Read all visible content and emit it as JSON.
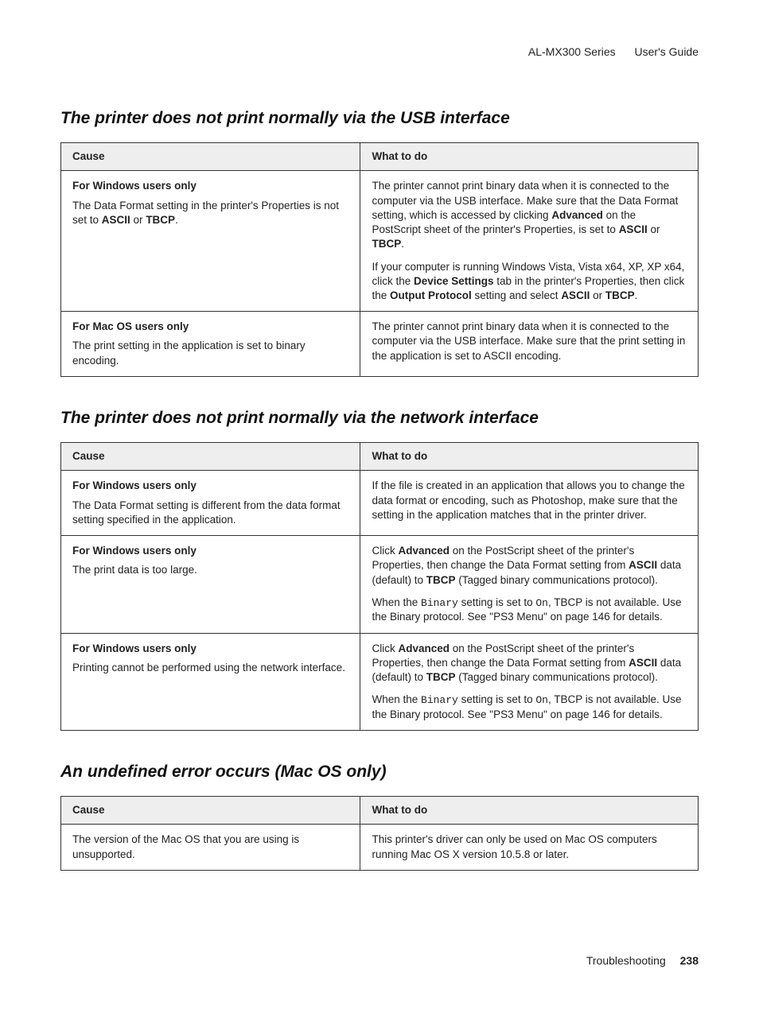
{
  "header": {
    "product": "AL-MX300 Series",
    "doc": "User's Guide"
  },
  "sections": {
    "s1": {
      "heading": "The printer does not print normally via the USB interface",
      "thCause": "Cause",
      "thWhat": "What to do",
      "rows": {
        "r1": {
          "causeTitle": "For Windows users only",
          "causeBody_a": "The Data Format setting in the printer's Properties is not set to ",
          "causeBody_b": " or ",
          "causeBody_c": ".",
          "do_p1_a": "The printer cannot print binary data when it is connected to the computer via the USB interface. Make sure that the Data Format setting, which is accessed by clicking ",
          "do_p1_b": " on the PostScript sheet of the printer's Properties, is set to ",
          "do_p1_c": " or ",
          "do_p1_d": ".",
          "do_p2_a": "If your computer is running Windows Vista, Vista x64, XP, XP x64, click the ",
          "do_p2_b": " tab in the printer's Properties, then click the ",
          "do_p2_c": " setting and select ",
          "do_p2_d": " or ",
          "do_p2_e": ".",
          "k_ascii": "ASCII",
          "k_tbcp": "TBCP",
          "k_adv": "Advanced",
          "k_devset": "Device Settings",
          "k_outproto": "Output Protocol"
        },
        "r2": {
          "causeTitle": "For Mac OS users only",
          "causeBody": "The print setting in the application is set to binary encoding.",
          "do": "The printer cannot print binary data when it is connected to the computer via the USB interface. Make sure that the print setting in the application is set to ASCII encoding."
        }
      }
    },
    "s2": {
      "heading": "The printer does not print normally via the network interface",
      "thCause": "Cause",
      "thWhat": "What to do",
      "rows": {
        "r1": {
          "causeTitle": "For Windows users only",
          "causeBody": "The Data Format setting is different from the data format setting specified in the application.",
          "do": "If the file is created in an application that allows you to change the data format or encoding, such as Photoshop, make sure that the setting in the application matches that in the printer driver."
        },
        "r2": {
          "causeTitle": "For Windows users only",
          "causeBody": "The print data is too large.",
          "do_p1_a": "Click ",
          "do_p1_b": " on the PostScript sheet of the printer's Properties, then change the Data Format setting from ",
          "do_p1_c": " data (default) to ",
          "do_p1_d": " (Tagged binary communications protocol).",
          "do_p2_a": "When the ",
          "do_p2_b": " setting is set to ",
          "do_p2_c": ", TBCP is not available. Use the Binary protocol. See \"PS3 Menu\" on page 146 for details.",
          "k_adv": "Advanced",
          "k_ascii": "ASCII",
          "k_tbcp": "TBCP",
          "k_binary": "Binary",
          "k_on": "On"
        },
        "r3": {
          "causeTitle": "For Windows users only",
          "causeBody": "Printing cannot be performed using the network interface.",
          "do_p1_a": "Click ",
          "do_p1_b": " on the PostScript sheet of the printer's Properties, then change the Data Format setting from ",
          "do_p1_c": " data (default) to ",
          "do_p1_d": " (Tagged binary communications protocol).",
          "do_p2_a": "When the ",
          "do_p2_b": " setting is set to ",
          "do_p2_c": ", TBCP is not available. Use the Binary protocol. See \"PS3 Menu\" on page 146 for details.",
          "k_adv": "Advanced",
          "k_ascii": "ASCII",
          "k_tbcp": "TBCP",
          "k_binary": "Binary",
          "k_on": "On"
        }
      }
    },
    "s3": {
      "heading": "An undefined error occurs (Mac OS only)",
      "thCause": "Cause",
      "thWhat": "What to do",
      "rows": {
        "r1": {
          "cause": "The version of the Mac OS that you are using is unsupported.",
          "do": "This printer's driver can only be used on Mac OS computers running Mac OS X version 10.5.8 or later."
        }
      }
    }
  },
  "footer": {
    "chapter": "Troubleshooting",
    "page": "238"
  }
}
